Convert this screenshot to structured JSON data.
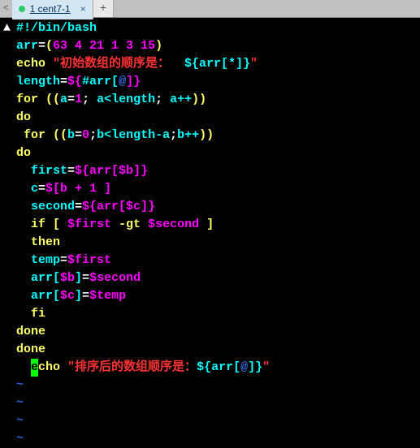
{
  "tab": {
    "index": "1",
    "title": "cent7-1",
    "close": "×",
    "add": "+"
  },
  "code": {
    "shebang": "#!/bin/bash",
    "arr_var": "arr",
    "eq": "=",
    "paren_open": "(",
    "paren_close": ")",
    "nums": "63 4 21 1 3 15",
    "echo": "echo ",
    "str1_open": "\"初始数组的顺序是：  ",
    "str1_var": "${arr[*]}",
    "str1_close": "\"",
    "length_var": "length",
    "length_expr_open": "${",
    "length_hash": "#arr[",
    "length_at": "@",
    "length_expr_close": "]}",
    "for1": "for",
    "for1_paren_open": " ((",
    "for1_a": "a",
    "for1_eq": "=",
    "for1_one": "1",
    "for1_semi1": "; ",
    "for1_lt": "a<length",
    "for1_semi2": "; ",
    "for1_inc": "a++",
    "for1_paren_close": "))",
    "do1": "do",
    "for2": " for",
    "for2_paren_open": " ((",
    "for2_b": "b",
    "for2_eq": "=",
    "for2_zero": "0",
    "for2_semi1": ";",
    "for2_lt": "b<length-a",
    "for2_semi2": ";",
    "for2_inc": "b++",
    "for2_paren_close": "))",
    "do2": "do",
    "first_var": "  first",
    "first_val": "${arr[$b]}",
    "c_var": "  c",
    "c_val": "$[b + 1 ]",
    "second_var": "  second",
    "second_val": "${arr[$c]}",
    "if_kw": "  if",
    "if_open": " [ ",
    "if_first": "$first",
    "if_gt": " -gt ",
    "if_second": "$second",
    "if_close": " ]",
    "then": "  then",
    "temp_var": "  temp",
    "temp_val": "$first",
    "arrb_var": "  arr[",
    "arrb_idx": "$b",
    "arrb_close": "]",
    "arrb_val": "$second",
    "arrc_var": "  arr[",
    "arrc_idx": "$c",
    "arrc_close": "]",
    "arrc_val": "$temp",
    "fi": "  fi",
    "done1": "done",
    "done2": "done",
    "echo2_prefix": "  ",
    "echo2_e": "e",
    "echo2_cho": "cho ",
    "str2_open": "\"排序后的数组顺序是：",
    "str2_var": "${arr[",
    "str2_at": "@",
    "str2_var_close": "]}",
    "str2_close": "\"",
    "tilde": "~"
  }
}
